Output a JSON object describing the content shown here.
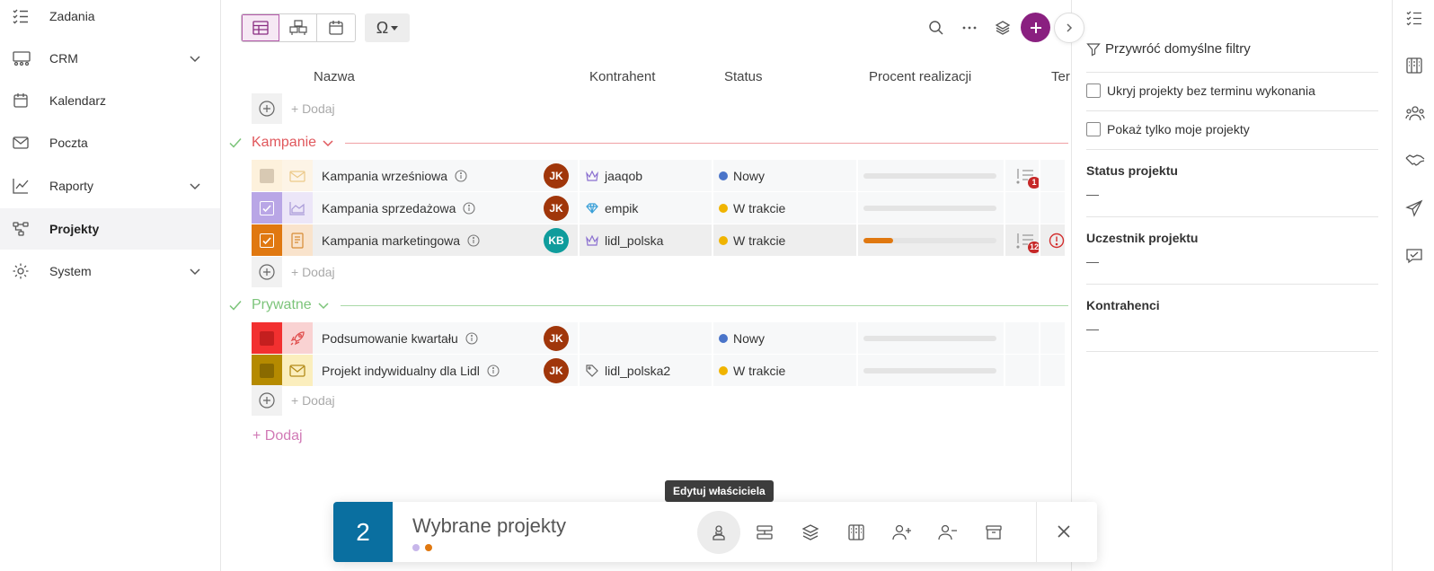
{
  "sidebar": {
    "items": [
      {
        "label": "Zadania",
        "icon": "task-list-icon",
        "expandable": false,
        "active": false
      },
      {
        "label": "CRM",
        "icon": "crm-people-icon",
        "expandable": true,
        "active": false
      },
      {
        "label": "Kalendarz",
        "icon": "calendar-icon",
        "expandable": false,
        "active": false
      },
      {
        "label": "Poczta",
        "icon": "mail-icon",
        "expandable": false,
        "active": false
      },
      {
        "label": "Raporty",
        "icon": "chart-line-icon",
        "expandable": true,
        "active": false
      },
      {
        "label": "Projekty",
        "icon": "project-nodes-icon",
        "expandable": false,
        "active": true
      },
      {
        "label": "System",
        "icon": "gear-icon",
        "expandable": true,
        "active": false
      }
    ]
  },
  "toolbar": {
    "views": [
      "table-view-icon",
      "boxes-view-icon",
      "calendar-view-icon"
    ],
    "active_view": "table-view-icon",
    "omega_symbol": "Ω"
  },
  "columns": {
    "name": "Nazwa",
    "contractor": "Kontrahent",
    "status": "Status",
    "progress": "Procent realizacji",
    "deadline": "Ter"
  },
  "add_label": "+ Dodaj",
  "groups": [
    {
      "name": "Kampanie",
      "color": "#e0575c",
      "line_color": "#f0a0a4",
      "rows": [
        {
          "name": "Kampania wrześniowa",
          "color": "#e9d8c2",
          "bg": "#fdf1dc",
          "checked": false,
          "type_icon": "mail-open-icon",
          "icon_color": "#e8c88a",
          "owner": "JK",
          "owner_color": "#a0360a",
          "contractor": "jaaqob",
          "contractor_icon": "crown-icon",
          "status": "Nowy",
          "status_color": "#4a74c9",
          "progress": 0,
          "tasks": "1",
          "alert": false
        },
        {
          "name": "Kampania sprzedażowa",
          "color": "#b9a6e6",
          "bg": "#ece6f8",
          "checked": true,
          "type_icon": "area-chart-icon",
          "icon_color": "#a99ad8",
          "owner": "JK",
          "owner_color": "#a0360a",
          "contractor": "empik",
          "contractor_icon": "diamond-icon",
          "status": "W trakcie",
          "status_color": "#f0b400",
          "progress": 0,
          "tasks": "",
          "alert": false
        },
        {
          "name": "Kampania marketingowa",
          "color": "#e07810",
          "bg": "#f9e3cc",
          "checked": true,
          "type_icon": "notebook-icon",
          "icon_color": "#d78a33",
          "owner": "KB",
          "owner_color": "#0f9c9c",
          "contractor": "lidl_polska",
          "contractor_icon": "crown-icon",
          "status": "W trakcie",
          "status_color": "#f0b400",
          "progress": 22,
          "tasks": "12",
          "alert": true
        }
      ]
    },
    {
      "name": "Prywatne",
      "color": "#7cc47a",
      "line_color": "#a9d9a7",
      "rows": [
        {
          "name": "Podsumowanie kwartału",
          "color": "#d82a2a",
          "bg": "#f9d2d2",
          "checked": false,
          "type_icon": "rocket-icon",
          "icon_color": "#e0504f",
          "owner": "JK",
          "owner_color": "#a0360a",
          "contractor": "",
          "contractor_icon": "",
          "status": "Nowy",
          "status_color": "#4a74c9",
          "progress": 0,
          "tasks": "",
          "alert": false
        },
        {
          "name": "Projekt indywidualny dla Lidl",
          "color": "#8a6a00",
          "bg": "#fbeebd",
          "checked": false,
          "type_icon": "mail-icon",
          "icon_color": "#b38b1a",
          "owner": "JK",
          "owner_color": "#a0360a",
          "contractor": "lidl_polska2",
          "contractor_icon": "tag-icon",
          "status": "W trakcie",
          "status_color": "#f0b400",
          "progress": 0,
          "tasks": "",
          "alert": false
        }
      ]
    }
  ],
  "filters": {
    "reset_label": "Przywróć domyślne filtry",
    "hide_no_deadline": "Ukryj projekty bez terminu wykonania",
    "only_mine": "Pokaż tylko moje projekty",
    "status_title": "Status projektu",
    "status_value": "—",
    "participant_title": "Uczestnik projektu",
    "participant_value": "—",
    "contractors_title": "Kontrahenci",
    "contractors_value": "—"
  },
  "rail_icons": [
    "task-list-icon",
    "kanban-icon",
    "people-icon",
    "handshake-icon",
    "send-icon",
    "chat-check-icon"
  ],
  "selection_bar": {
    "count": "2",
    "title": "Wybrane projekty",
    "dot_colors": [
      "#c7b6ea",
      "#e07810"
    ],
    "tooltip": "Edytuj właściciela",
    "actions": [
      "edit-owner-icon",
      "group-icon",
      "layers-icon",
      "kanban-icon",
      "add-user-icon",
      "remove-user-icon",
      "archive-icon"
    ]
  },
  "colors": {
    "accent": "#8a2080",
    "selection_count_bg": "#0a6fa0"
  }
}
